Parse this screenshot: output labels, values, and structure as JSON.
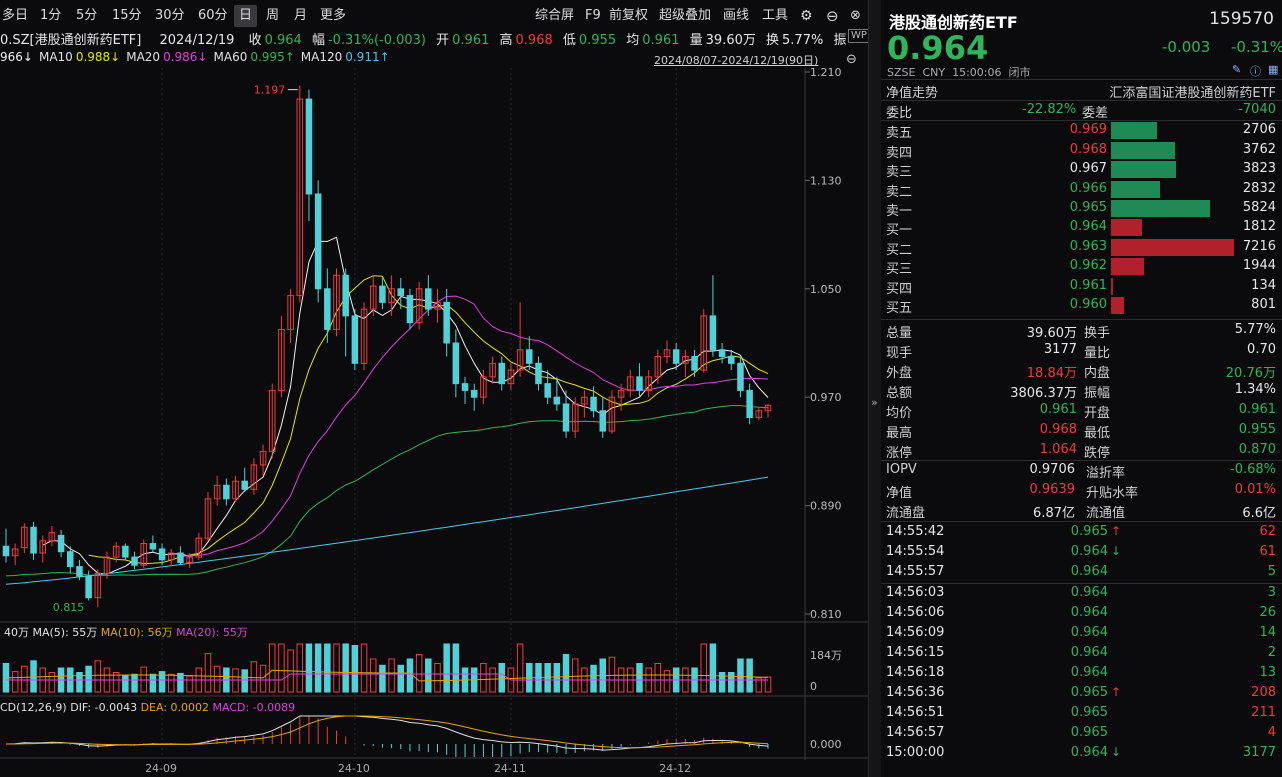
{
  "toolbar": {
    "items": [
      "多日",
      "1分",
      "5分",
      "15分",
      "30分",
      "60分",
      "日",
      "周",
      "月",
      "更多"
    ],
    "right": [
      "综合屏",
      "F9",
      "前复权",
      "超级叠加",
      "画线",
      "工具"
    ]
  },
  "info": {
    "code": "0.SZ[港股通创新药ETF]",
    "date": "2024/12/19",
    "close_label": "收",
    "close": "0.964",
    "amp_label": "幅",
    "amp": "-0.31%(-0.003)",
    "open_label": "开",
    "open": "0.961",
    "high_label": "高",
    "high": "0.968",
    "low_label": "低",
    "low": "0.955",
    "avg_label": "均",
    "avg": "0.961",
    "vol_label": "量",
    "vol": "39.60万",
    "turn_label": "换",
    "turn": "5.77%",
    "zhen": "振"
  },
  "ma_legend": [
    {
      "label": "",
      "value": "966↓",
      "color": "#f2f2f2"
    },
    {
      "label": "MA10",
      "value": "0.988↓",
      "color": "#e6e600"
    },
    {
      "label": "MA20",
      "value": "0.986↓",
      "color": "#e040e0"
    },
    {
      "label": "MA60",
      "value": "0.995↑",
      "color": "#2fb55c"
    },
    {
      "label": "MA120",
      "value": "0.911↑",
      "color": "#49c8e6"
    }
  ],
  "range_label": "2024/08/07-2024/12/19(90日)",
  "price_axis": [
    "1.210",
    "1.130",
    "1.050",
    "0.970",
    "0.890",
    "0.810"
  ],
  "max_label": "1.197",
  "min_label": "0.815",
  "vol_legend": {
    "vol": "40万",
    "ma5_label": "MA(5):",
    "ma5": "55万",
    "ma10_label": "MA(10):",
    "ma10": "56万",
    "ma20_label": "MA(20):",
    "ma20": "55万"
  },
  "vol_axis": [
    "184万",
    "0"
  ],
  "macd_legend": {
    "title": "CD(12,26,9)",
    "dif_label": "DIF:",
    "dif": "-0.0043",
    "dea_label": "DEA:",
    "dea": "0.0002",
    "macd_label": "MACD:",
    "macd": "-0.0089"
  },
  "macd_axis": "0.000",
  "date_axis": [
    "24-09",
    "24-10",
    "24-11",
    "24-12"
  ],
  "quote": {
    "name": "港股通创新药ETF",
    "code": "159570",
    "price": "0.964",
    "change": "-0.003",
    "pct": "-0.31%",
    "market": "SZSE",
    "currency": "CNY",
    "time": "15:00:06",
    "status": "闭市"
  },
  "nav_row": {
    "left": "净值走势",
    "right": "汇添富国证港股通创新药ETF"
  },
  "webi": {
    "label": "委比",
    "value": "-22.82%",
    "label2": "委差",
    "value2": "-7040"
  },
  "asks": [
    {
      "label": "卖五",
      "price": "0.969",
      "vol": "2706",
      "ratio": 0.31
    },
    {
      "label": "卖四",
      "price": "0.968",
      "vol": "3762",
      "ratio": 0.43
    },
    {
      "label": "卖三",
      "price": "0.967",
      "vol": "3823",
      "ratio": 0.44
    },
    {
      "label": "卖二",
      "price": "0.966",
      "vol": "2832",
      "ratio": 0.33
    },
    {
      "label": "卖一",
      "price": "0.965",
      "vol": "5824",
      "ratio": 0.67
    }
  ],
  "bids": [
    {
      "label": "买一",
      "price": "0.964",
      "vol": "1812",
      "ratio": 0.21
    },
    {
      "label": "买二",
      "price": "0.963",
      "vol": "7216",
      "ratio": 0.83
    },
    {
      "label": "买三",
      "price": "0.962",
      "vol": "1944",
      "ratio": 0.22
    },
    {
      "label": "买四",
      "price": "0.961",
      "vol": "134",
      "ratio": 0.015
    },
    {
      "label": "买五",
      "price": "0.960",
      "vol": "801",
      "ratio": 0.09
    }
  ],
  "stats": [
    {
      "l1": "总量",
      "v1": "39.60万",
      "c1": "wt",
      "l2": "换手",
      "v2": "5.77%",
      "c2": "wt"
    },
    {
      "l1": "现手",
      "v1": "3177",
      "c1": "wt",
      "l2": "量比",
      "v2": "0.70",
      "c2": "wt"
    },
    {
      "l1": "外盘",
      "v1": "18.84万",
      "c1": "up",
      "l2": "内盘",
      "v2": "20.76万",
      "c2": "dn"
    },
    {
      "l1": "总额",
      "v1": "3806.37万",
      "c1": "wt",
      "l2": "振幅",
      "v2": "1.34%",
      "c2": "wt"
    },
    {
      "l1": "均价",
      "v1": "0.961",
      "c1": "dn",
      "l2": "开盘",
      "v2": "0.961",
      "c2": "dn"
    },
    {
      "l1": "最高",
      "v1": "0.968",
      "c1": "up",
      "l2": "最低",
      "v2": "0.955",
      "c2": "dn"
    },
    {
      "l1": "涨停",
      "v1": "1.064",
      "c1": "up",
      "l2": "跌停",
      "v2": "0.870",
      "c2": "dn"
    }
  ],
  "stats2": [
    {
      "l1": "IOPV",
      "v1": "0.9706",
      "c1": "wt",
      "l2": "溢折率",
      "v2": "-0.68%",
      "c2": "dn"
    },
    {
      "l1": "净值",
      "v1": "0.9639",
      "c1": "up",
      "l2": "升贴水率",
      "v2": "0.01%",
      "c2": "up"
    },
    {
      "l1": "流通盘",
      "v1": "6.87亿",
      "c1": "wt",
      "l2": "流通值",
      "v2": "6.6亿",
      "c2": "wt"
    }
  ],
  "ticks": [
    {
      "time": "14:55:42",
      "price": "0.965",
      "arrow": "↑",
      "vol": "62",
      "vc": "up"
    },
    {
      "time": "14:55:54",
      "price": "0.964",
      "arrow": "↓",
      "vol": "61",
      "vc": "up"
    },
    {
      "time": "14:55:57",
      "price": "0.964",
      "arrow": "",
      "vol": "5",
      "vc": "dn"
    },
    {
      "time": "14:56:03",
      "price": "0.964",
      "arrow": "",
      "vol": "3",
      "vc": "dn"
    },
    {
      "time": "14:56:06",
      "price": "0.964",
      "arrow": "",
      "vol": "26",
      "vc": "dn"
    },
    {
      "time": "14:56:09",
      "price": "0.964",
      "arrow": "",
      "vol": "14",
      "vc": "dn"
    },
    {
      "time": "14:56:15",
      "price": "0.964",
      "arrow": "",
      "vol": "2",
      "vc": "dn"
    },
    {
      "time": "14:56:18",
      "price": "0.964",
      "arrow": "",
      "vol": "13",
      "vc": "dn"
    },
    {
      "time": "14:56:36",
      "price": "0.965",
      "arrow": "↑",
      "vol": "208",
      "vc": "up"
    },
    {
      "time": "14:56:51",
      "price": "0.965",
      "arrow": "",
      "vol": "211",
      "vc": "up"
    },
    {
      "time": "14:56:57",
      "price": "0.965",
      "arrow": "",
      "vol": "4",
      "vc": "up"
    },
    {
      "time": "15:00:00",
      "price": "0.964",
      "arrow": "↓",
      "vol": "3177",
      "vc": "dn"
    }
  ],
  "colors": {
    "up": "#f23a3a",
    "down": "#2fb55c",
    "candle_down": "#4fd1d9",
    "ask_bar": "#1e8a55",
    "bid_bar": "#b0212b"
  },
  "chart_data": {
    "type": "candlestick",
    "ylim": [
      0.81,
      1.21
    ],
    "candles": [
      [
        0.86,
        0.873,
        0.848,
        0.853
      ],
      [
        0.853,
        0.862,
        0.846,
        0.858
      ],
      [
        0.859,
        0.877,
        0.855,
        0.874
      ],
      [
        0.874,
        0.878,
        0.85,
        0.855
      ],
      [
        0.855,
        0.868,
        0.848,
        0.864
      ],
      [
        0.864,
        0.875,
        0.86,
        0.87
      ],
      [
        0.868,
        0.872,
        0.852,
        0.856
      ],
      [
        0.856,
        0.86,
        0.84,
        0.845
      ],
      [
        0.845,
        0.85,
        0.835,
        0.838
      ],
      [
        0.838,
        0.842,
        0.82,
        0.822
      ],
      [
        0.822,
        0.843,
        0.815,
        0.84
      ],
      [
        0.84,
        0.856,
        0.836,
        0.852
      ],
      [
        0.852,
        0.863,
        0.848,
        0.86
      ],
      [
        0.86,
        0.862,
        0.85,
        0.852
      ],
      [
        0.852,
        0.856,
        0.843,
        0.846
      ],
      [
        0.846,
        0.865,
        0.844,
        0.862
      ],
      [
        0.862,
        0.868,
        0.855,
        0.858
      ],
      [
        0.858,
        0.862,
        0.846,
        0.85
      ],
      [
        0.85,
        0.858,
        0.845,
        0.855
      ],
      [
        0.855,
        0.86,
        0.846,
        0.848
      ],
      [
        0.848,
        0.855,
        0.844,
        0.852
      ],
      [
        0.852,
        0.87,
        0.85,
        0.866
      ],
      [
        0.866,
        0.9,
        0.864,
        0.895
      ],
      [
        0.895,
        0.912,
        0.89,
        0.905
      ],
      [
        0.905,
        0.91,
        0.89,
        0.895
      ],
      [
        0.895,
        0.912,
        0.893,
        0.908
      ],
      [
        0.908,
        0.918,
        0.9,
        0.902
      ],
      [
        0.902,
        0.925,
        0.898,
        0.92
      ],
      [
        0.92,
        0.935,
        0.912,
        0.93
      ],
      [
        0.93,
        0.98,
        0.925,
        0.975
      ],
      [
        0.975,
        1.03,
        0.97,
        1.02
      ],
      [
        1.02,
        1.05,
        1.01,
        1.045
      ],
      [
        1.045,
        1.2,
        1.04,
        1.19
      ],
      [
        1.19,
        1.197,
        1.1,
        1.12
      ],
      [
        1.12,
        1.13,
        1.04,
        1.05
      ],
      [
        1.05,
        1.065,
        1.01,
        1.02
      ],
      [
        1.02,
        1.065,
        1.015,
        1.06
      ],
      [
        1.06,
        1.065,
        1.0,
        1.03
      ],
      [
        1.03,
        1.035,
        0.99,
        0.995
      ],
      [
        0.995,
        1.04,
        0.99,
        1.035
      ],
      [
        1.035,
        1.06,
        1.03,
        1.052
      ],
      [
        1.052,
        1.058,
        1.035,
        1.04
      ],
      [
        1.04,
        1.06,
        1.03,
        1.05
      ],
      [
        1.05,
        1.058,
        1.035,
        1.045
      ],
      [
        1.045,
        1.05,
        1.02,
        1.025
      ],
      [
        1.025,
        1.055,
        1.02,
        1.05
      ],
      [
        1.05,
        1.06,
        1.03,
        1.035
      ],
      [
        1.035,
        1.05,
        1.025,
        1.04
      ],
      [
        1.04,
        1.05,
        1.0,
        1.01
      ],
      [
        1.01,
        1.02,
        0.97,
        0.98
      ],
      [
        0.98,
        0.985,
        0.965,
        0.975
      ],
      [
        0.975,
        0.98,
        0.96,
        0.97
      ],
      [
        0.97,
        0.99,
        0.965,
        0.985
      ],
      [
        0.985,
        1.0,
        0.98,
        0.995
      ],
      [
        0.995,
        1.0,
        0.975,
        0.98
      ],
      [
        0.98,
        0.995,
        0.975,
        0.99
      ],
      [
        0.99,
        1.04,
        0.985,
        1.005
      ],
      [
        1.005,
        1.015,
        0.99,
        0.995
      ],
      [
        0.995,
        1.0,
        0.975,
        0.98
      ],
      [
        0.98,
        0.99,
        0.965,
        0.97
      ],
      [
        0.97,
        0.985,
        0.96,
        0.965
      ],
      [
        0.965,
        0.975,
        0.94,
        0.945
      ],
      [
        0.945,
        0.97,
        0.94,
        0.965
      ],
      [
        0.965,
        0.975,
        0.955,
        0.97
      ],
      [
        0.97,
        0.978,
        0.955,
        0.96
      ],
      [
        0.96,
        0.97,
        0.94,
        0.945
      ],
      [
        0.945,
        0.975,
        0.943,
        0.97
      ],
      [
        0.97,
        0.98,
        0.96,
        0.975
      ],
      [
        0.975,
        0.99,
        0.97,
        0.985
      ],
      [
        0.985,
        0.995,
        0.97,
        0.975
      ],
      [
        0.975,
        0.99,
        0.97,
        0.985
      ],
      [
        0.985,
        1.005,
        0.98,
        1.0
      ],
      [
        1.0,
        1.012,
        0.995,
        1.005
      ],
      [
        1.005,
        1.01,
        0.99,
        0.995
      ],
      [
        0.995,
        1.005,
        0.985,
        1.0
      ],
      [
        1.0,
        1.005,
        0.985,
        0.99
      ],
      [
        0.99,
        1.035,
        0.988,
        1.03
      ],
      [
        1.03,
        1.06,
        1.0,
        1.005
      ],
      [
        1.005,
        1.01,
        0.995,
        1.0
      ],
      [
        1.0,
        1.005,
        0.99,
        0.995
      ],
      [
        0.995,
        1.0,
        0.97,
        0.975
      ],
      [
        0.975,
        0.98,
        0.95,
        0.955
      ],
      [
        0.955,
        0.962,
        0.953,
        0.96
      ],
      [
        0.96,
        0.965,
        0.955,
        0.964
      ]
    ]
  }
}
